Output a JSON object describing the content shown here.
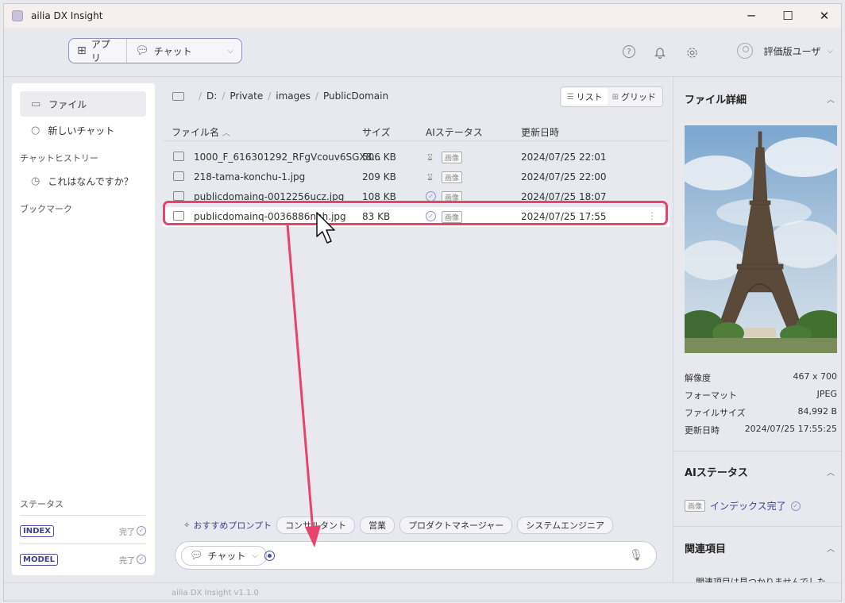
{
  "window": {
    "title": "ailia DX Insight",
    "minimize": "─",
    "maximize": "☐",
    "close": "✕"
  },
  "header": {
    "app_label": "アプリ",
    "mode_label": "チャット",
    "user_label": "評価版ユーザ"
  },
  "sidebar": {
    "items": [
      {
        "label": "ファイル"
      },
      {
        "label": "新しいチャット"
      }
    ],
    "history_heading": "チャットヒストリー",
    "history_items": [
      {
        "label": "これはなんですか？"
      }
    ],
    "bookmark_heading": "ブックマーク",
    "status_heading": "ステータス",
    "statuses": [
      {
        "badge": "INDEX",
        "state": "完了"
      },
      {
        "badge": "MODEL",
        "state": "完了"
      }
    ]
  },
  "breadcrumb": [
    "D:",
    "Private",
    "images",
    "PublicDomain"
  ],
  "view": {
    "list_label": "リスト",
    "grid_label": "グリッド"
  },
  "table": {
    "headers": {
      "name": "ファイル名",
      "size": "サイズ",
      "ai": "AIステータス",
      "date": "更新日時"
    },
    "rows": [
      {
        "name": "1000_F_616301292_RFgVcouv6SGX8...",
        "size": "506 KB",
        "ai_state": "pending",
        "tag": "画像",
        "date": "2024/07/25 22:01"
      },
      {
        "name": "218-tama-konchu-1.jpg",
        "size": "209 KB",
        "ai_state": "pending",
        "tag": "画像",
        "date": "2024/07/25 22:00"
      },
      {
        "name": "publicdomainq-0012256ucz.jpg",
        "size": "108 KB",
        "ai_state": "done",
        "tag": "画像",
        "date": "2024/07/25 18:07"
      },
      {
        "name": "publicdomainq-0036886nhh.jpg",
        "size": "83 KB",
        "ai_state": "done",
        "tag": "画像",
        "date": "2024/07/25 17:55"
      }
    ]
  },
  "prompts": {
    "label": "おすすめプロンプト",
    "chips": [
      "コンサルタント",
      "営業",
      "プロダクトマネージャー",
      "システムエンジニア"
    ]
  },
  "chat": {
    "mode_label": "チャット"
  },
  "details": {
    "title": "ファイル詳細",
    "fields": [
      {
        "key": "解像度",
        "value": "467 x 700"
      },
      {
        "key": "フォーマット",
        "value": "JPEG"
      },
      {
        "key": "ファイルサイズ",
        "value": "84,992 B"
      },
      {
        "key": "更新日時",
        "value": "2024/07/25 17:55:25"
      }
    ]
  },
  "ai_status": {
    "title": "AIステータス",
    "tag": "画像",
    "text": "インデックス完了"
  },
  "related": {
    "title": "関連項目",
    "empty_text": "関連項目は見つかりませんでした"
  },
  "footer": {
    "version": "ailia DX Insight v1.1.0"
  },
  "colors": {
    "accent": "#3d3f93",
    "highlight": "#e8436d"
  }
}
